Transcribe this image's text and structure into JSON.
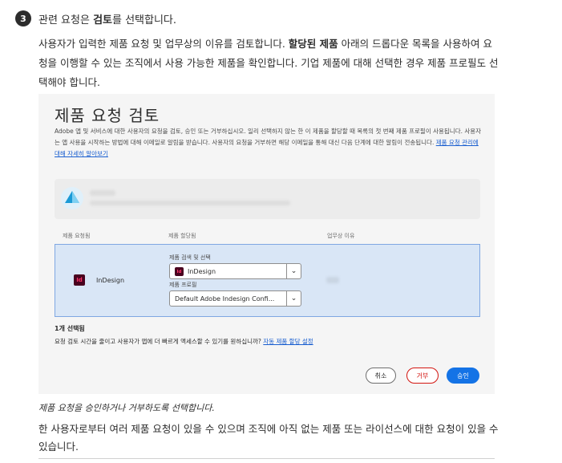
{
  "step": {
    "number": "3",
    "title_prefix": "관련 요청은 ",
    "title_bold": "검토",
    "title_suffix": "를 선택합니다."
  },
  "intro": {
    "part1": "사용자가 입력한 제품 요청 및 업무상의 이유를 검토합니다. ",
    "bold": "할당된 제품",
    "part2": " 아래의 드롭다운 목록을 사용하여 요청을 이행할 수 있는 조직에서 사용 가능한 제품을 확인합니다. 기업 제품에 대해 선택한 경우 제품 프로필도 선택해야 합니다."
  },
  "dialog": {
    "title": "제품 요청 검토",
    "description": "Adobe 앱 및 서비스에 대한 사용자의 요청을 검토, 승인 또는 거부하십시오. 일리 선택하지 않는 한 이 제품을 할당할 때 목록의 첫 번째 제품 프로필이 사용됩니다. 사용자는 앱 사용을 시작하는 방법에 대해 이메일로 알림을 받습니다. 사용자의 요청을 거부하면 해당 이메일을 통해 대신 다음 단계에 대한 알림이 전송됩니다. ",
    "description_link": "제품 요청 관리에 대해 자세히 알아보기",
    "columns": {
      "requested": "제품 요청됨",
      "assigned": "제품 할당됨",
      "reason": "업무상 이유"
    },
    "row": {
      "icon_text": "Id",
      "product": "InDesign",
      "search_label": "제품 검색 및 선택",
      "search_value": "InDesign",
      "profile_label": "제품 프로필",
      "profile_value": "Default Adobe Indesign Confi...",
      "chevron": "⌄"
    },
    "selected_count": "1개 선택됨",
    "auto_note": "요청 검토 시간을 줄이고 사용자가 앱에 더 빠르게 액세스할 수 있기를 원하십니까? ",
    "auto_link": "자동 제품 할당 설정",
    "buttons": {
      "cancel": "취소",
      "reject": "거부",
      "approve": "승인"
    },
    "colors": {
      "approve": "#1473e6",
      "reject": "#d31510",
      "row_highlight": "#d9e6f6"
    }
  },
  "caption": "제품 요청을 승인하거나 거부하도록 선택합니다.",
  "outro": "한 사용자로부터 여러 제품 요청이 있을 수 있으며 조직에 아직 없는 제품 또는 라이선스에 대한 요청이 있을 수 있습니다."
}
